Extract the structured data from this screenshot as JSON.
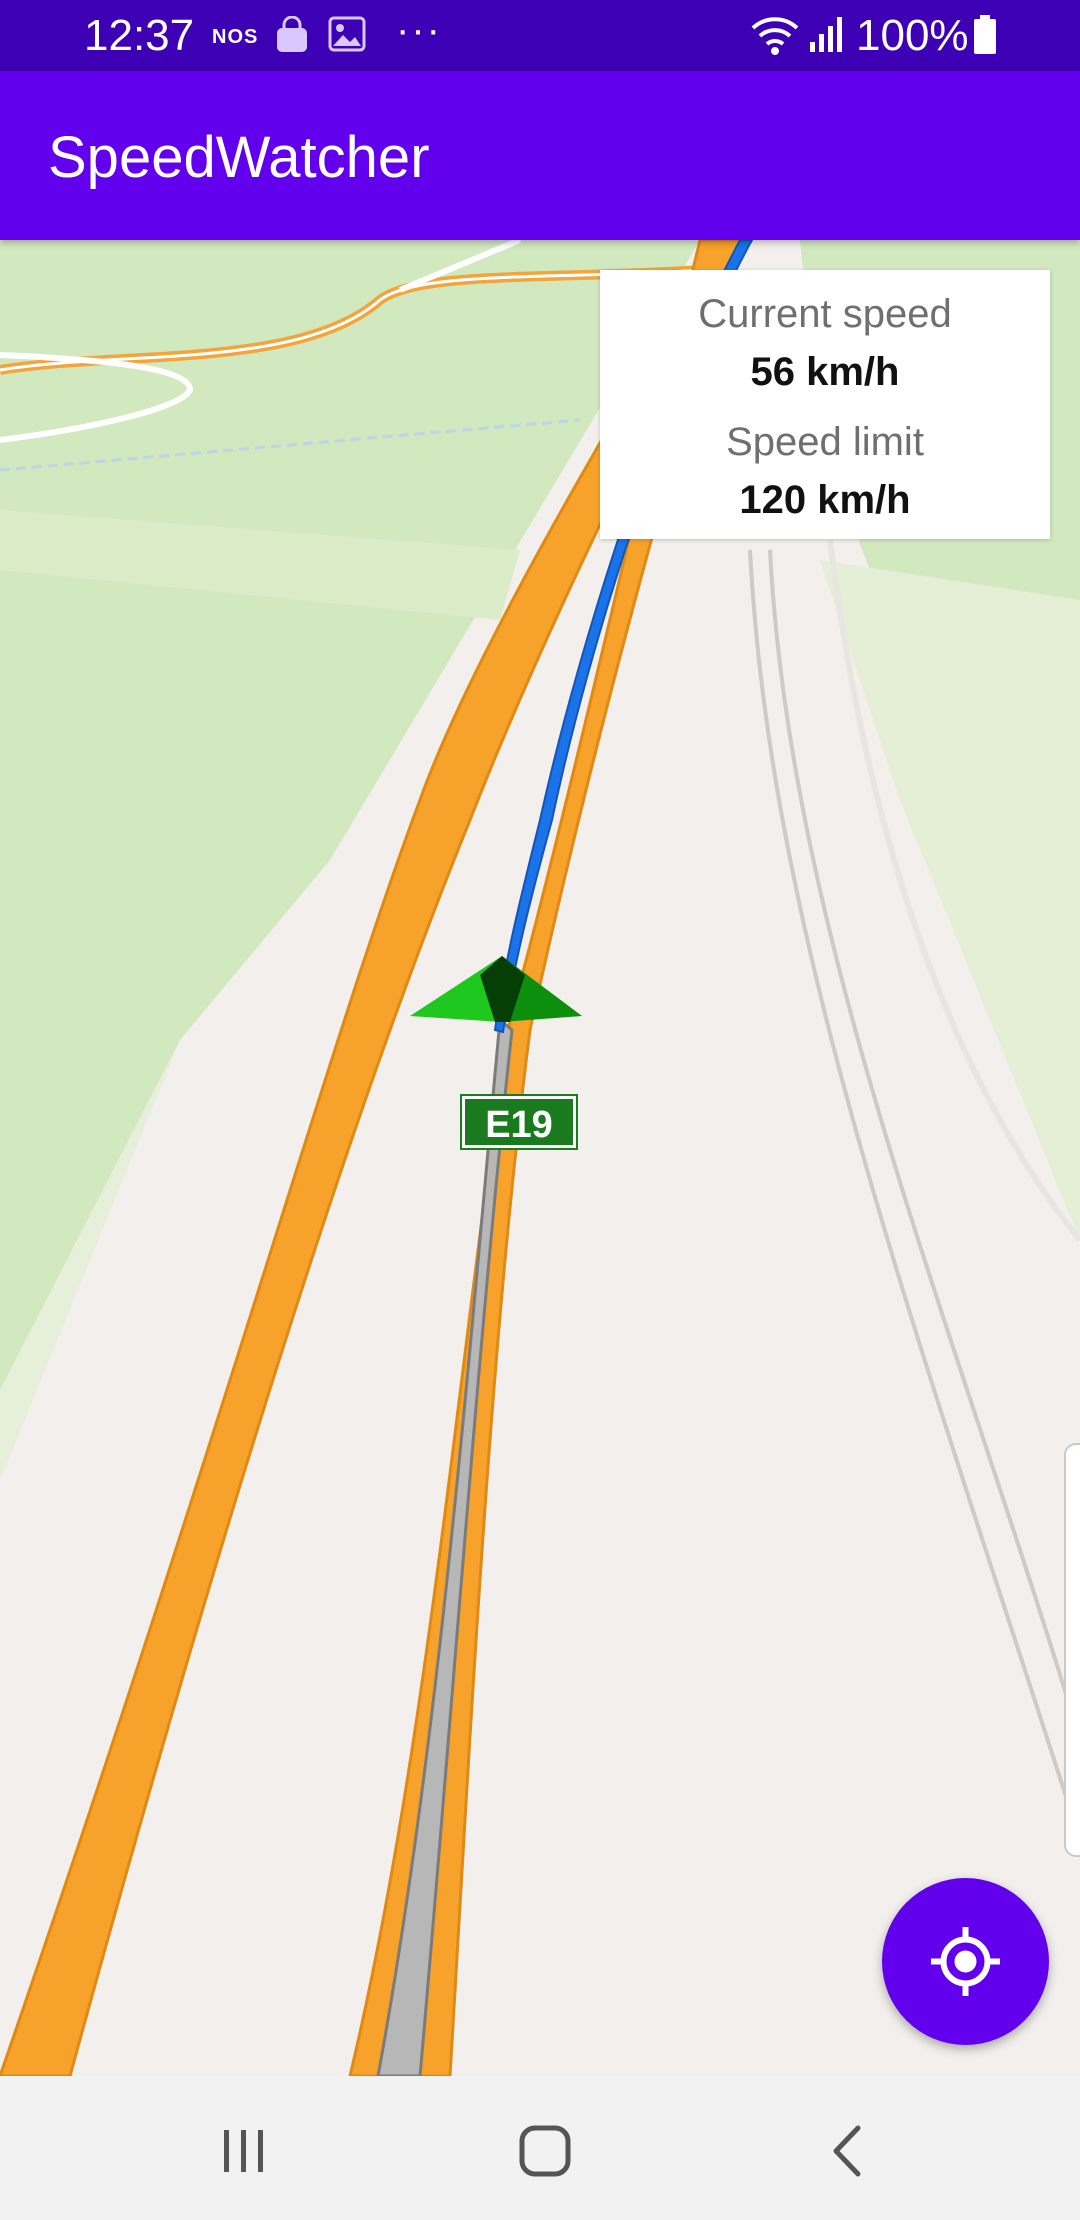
{
  "status_bar": {
    "time": "12:37",
    "carrier": "NOS",
    "battery": "100%",
    "more": "···",
    "icons": [
      "shopping-bag-icon",
      "image-icon",
      "wifi-icon",
      "signal-icon",
      "battery-icon"
    ]
  },
  "app_bar": {
    "title": "SpeedWatcher",
    "color": "#6200ee"
  },
  "speed_card": {
    "current_speed_label": "Current speed",
    "current_speed_value": "56 km/h",
    "speed_limit_label": "Speed limit",
    "speed_limit_value": "120 km/h"
  },
  "map": {
    "road_shield": "E19",
    "colors": {
      "highway": "#f6a22b",
      "route": "#1a73e8",
      "grass": "#d2e8bf",
      "land": "#f2efec",
      "position_marker": "#1fc81f"
    }
  },
  "fab": {
    "icon": "my-location-icon"
  },
  "nav_bar": {
    "icons": [
      "recent-apps-icon",
      "home-icon",
      "back-icon"
    ]
  }
}
